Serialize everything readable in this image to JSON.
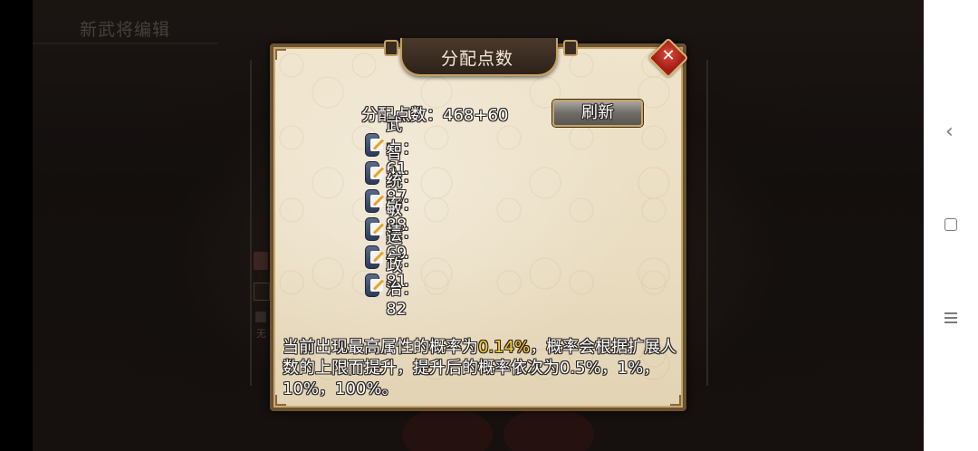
{
  "background": {
    "title": "新武将编辑",
    "side_label": "无"
  },
  "dialog": {
    "title": "分配点数",
    "points_label": "分配点数：468+60",
    "refresh_button": "刷新",
    "stats": [
      {
        "label": "武力：61"
      },
      {
        "label": "智力：87"
      },
      {
        "label": "统率：88"
      },
      {
        "label": "敏捷：69"
      },
      {
        "label": "运气：81"
      },
      {
        "label": "政治：82"
      }
    ],
    "notice": {
      "prefix": "当前出现最高属性的概率为",
      "highlight": "0.14%",
      "suffix": "，概率会根据扩展人数的上限而提升，提升后的概率依次为0.5%，1%，10%，100%。"
    }
  },
  "colors": {
    "highlight": "#ffcf3a",
    "close_button": "#c0281e",
    "dialog_bg": "#ece1c7"
  },
  "icons": {
    "close": "close-x-icon",
    "stat_edit": "edit-note-icon",
    "nav_back": "chevron-left-icon",
    "nav_home": "square-icon",
    "nav_menu": "hamburger-icon"
  }
}
